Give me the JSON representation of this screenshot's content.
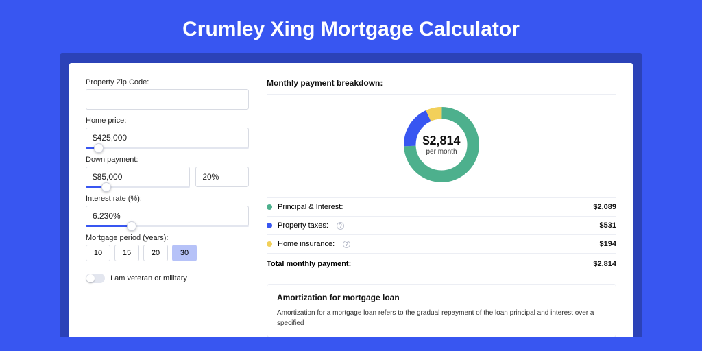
{
  "title": "Crumley Xing Mortgage Calculator",
  "colors": {
    "principal": "#4db08d",
    "taxes": "#3856f1",
    "insurance": "#f2d05a"
  },
  "form": {
    "zip": {
      "label": "Property Zip Code:",
      "value": ""
    },
    "home_price": {
      "label": "Home price:",
      "value": "$425,000",
      "slider_pct": 8
    },
    "down_payment": {
      "label": "Down payment:",
      "value": "$85,000",
      "pct_value": "20%",
      "slider_pct": 20
    },
    "interest": {
      "label": "Interest rate (%):",
      "value": "6.230%",
      "slider_pct": 28
    },
    "period": {
      "label": "Mortgage period (years):",
      "options": [
        "10",
        "15",
        "20",
        "30"
      ],
      "selected": "30"
    },
    "veteran": {
      "label": "I am veteran or military",
      "checked": false
    }
  },
  "breakdown": {
    "title": "Monthly payment breakdown:",
    "total_amount": "$2,814",
    "total_per": "per month",
    "items": [
      {
        "label": "Principal & Interest:",
        "value": "$2,089",
        "color": "#4db08d",
        "info": false
      },
      {
        "label": "Property taxes:",
        "value": "$531",
        "color": "#3856f1",
        "info": true
      },
      {
        "label": "Home insurance:",
        "value": "$194",
        "color": "#f2d05a",
        "info": true
      }
    ],
    "total_label": "Total monthly payment:",
    "total_value": "$2,814"
  },
  "chart_data": {
    "type": "pie",
    "title": "Monthly payment breakdown",
    "series": [
      {
        "name": "Principal & Interest",
        "value": 2089,
        "color": "#4db08d"
      },
      {
        "name": "Property taxes",
        "value": 531,
        "color": "#3856f1"
      },
      {
        "name": "Home insurance",
        "value": 194,
        "color": "#f2d05a"
      }
    ],
    "center_label": "$2,814",
    "center_sub": "per month"
  },
  "amortization": {
    "title": "Amortization for mortgage loan",
    "text": "Amortization for a mortgage loan refers to the gradual repayment of the loan principal and interest over a specified"
  }
}
